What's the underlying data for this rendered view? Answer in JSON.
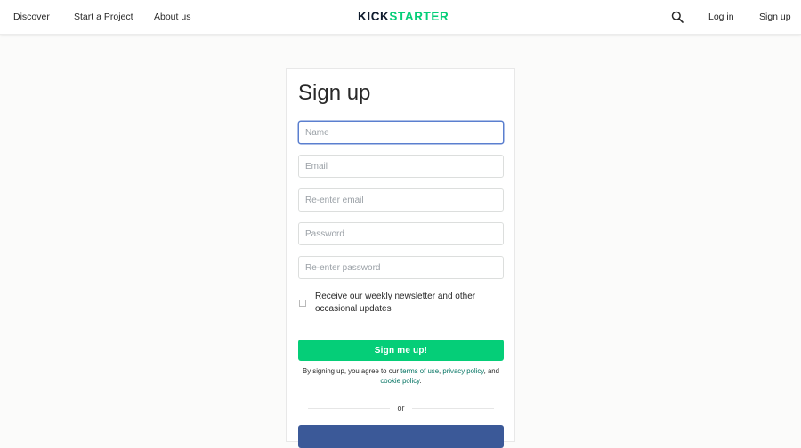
{
  "nav": {
    "discover": "Discover",
    "start_project": "Start a Project",
    "about": "About us",
    "logo_part1": "KICK",
    "logo_part2": "STARTER",
    "search_icon": "search-icon",
    "login": "Log in",
    "signup": "Sign up"
  },
  "colors": {
    "brand_green": "#05ce78",
    "brand_dark": "#0f1b2d",
    "link_green": "#037362",
    "facebook_blue": "#3b5998",
    "focus_blue": "#5b7fcf"
  },
  "form": {
    "title": "Sign up",
    "name_placeholder": "Name",
    "email_placeholder": "Email",
    "reemail_placeholder": "Re-enter email",
    "password_placeholder": "Password",
    "repassword_placeholder": "Re-enter password",
    "newsletter_label": "Receive our weekly newsletter and other occasional updates",
    "submit_label": "Sign me up!",
    "legal_prefix": "By signing up, you agree to our",
    "terms_link": "terms of use",
    "comma1": ",",
    "privacy_link": "privacy policy",
    "and_text": ", and",
    "cookie_link": "cookie policy",
    "period": ".",
    "or_text": "or"
  }
}
